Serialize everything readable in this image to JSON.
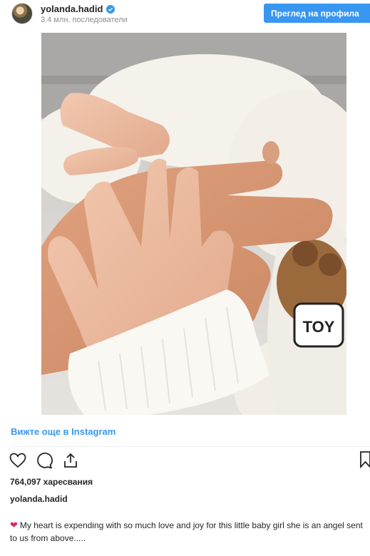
{
  "header": {
    "username": "yolanda.hadid",
    "followers": "3.4 млн. последователи",
    "view_profile_label": "Преглед на профила"
  },
  "post": {
    "view_more_label": "Вижте още в Instagram",
    "likes": "764,097 харесвания",
    "caption_user": "yolanda.hadid",
    "caption_text": "My heart is expending with so much love and joy for this little baby girl she is an angel sent to us from above.....",
    "caption_emoji": "❤"
  },
  "photo": {
    "garment_text": "TOY"
  },
  "icons": {
    "verified": "verified-badge-icon",
    "like": "heart-icon",
    "comment": "comment-icon",
    "share": "share-icon",
    "save": "bookmark-icon"
  },
  "colors": {
    "accent": "#3897f0",
    "text": "#262626",
    "muted": "#8e8e8e",
    "heart": "#e0245e"
  }
}
